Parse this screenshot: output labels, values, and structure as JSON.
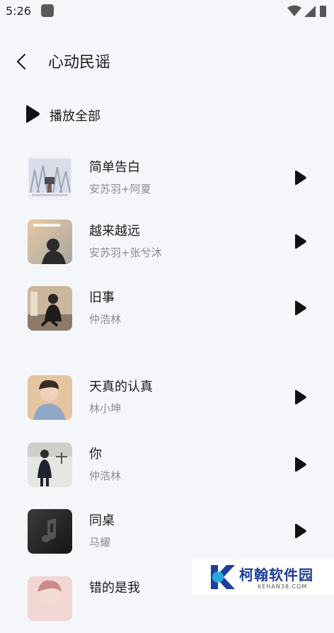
{
  "status_bar": {
    "time": "5:26"
  },
  "header": {
    "title": "心动民谣",
    "back_icon": "chevron-left-icon"
  },
  "play_all": {
    "label": "播放全部",
    "icon": "play-icon"
  },
  "songs": [
    {
      "title": "简单告白",
      "artist": "安苏羽+阿夏"
    },
    {
      "title": "越来越远",
      "artist": "安苏羽+张兮沐"
    },
    {
      "title": "旧事",
      "artist": "仲浩林"
    },
    {
      "title": "天真的认真",
      "artist": "林小坤"
    },
    {
      "title": "你",
      "artist": "仲浩林"
    },
    {
      "title": "同桌",
      "artist": "马耀"
    },
    {
      "title": "错的是我",
      "artist": ""
    }
  ],
  "watermark": {
    "name": "柯翰软件园",
    "domain": "KEHAN38.COM"
  },
  "colors": {
    "background": "#f5f6fa",
    "text": "#1c1c1c",
    "subtext": "#8c8c8c",
    "brand": "#1e3f9a"
  }
}
